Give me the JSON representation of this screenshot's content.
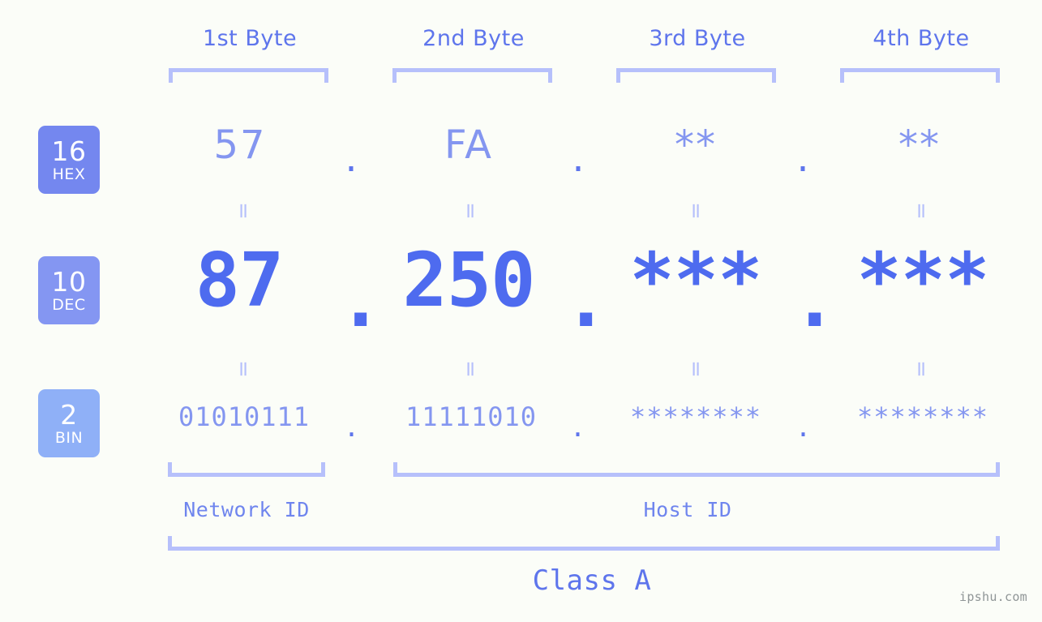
{
  "background_color": "#fbfdf8",
  "accent_color": "#4e6bef",
  "bracket_color": "#b6c0fb",
  "headers": [
    {
      "label": "1st Byte"
    },
    {
      "label": "2nd Byte"
    },
    {
      "label": "3rd Byte"
    },
    {
      "label": "4th Byte"
    }
  ],
  "bases": {
    "hex": {
      "number": "16",
      "name": "HEX",
      "color": "#7487ef"
    },
    "dec": {
      "number": "10",
      "name": "DEC",
      "color": "#8496f2"
    },
    "bin": {
      "number": "2",
      "name": "BIN",
      "color": "#8fb0f7"
    }
  },
  "rows": {
    "hex": {
      "values": [
        "57",
        "FA",
        "**",
        "**"
      ],
      "separator": "."
    },
    "dec": {
      "values": [
        "87",
        "250",
        "***",
        "***"
      ],
      "separator": "."
    },
    "bin": {
      "values": [
        "01010111",
        "11111010",
        "********",
        "********"
      ],
      "separator": "."
    }
  },
  "equality_symbol": "=",
  "sections": {
    "network_id": "Network ID",
    "host_id": "Host ID",
    "class": "Class A"
  },
  "watermark": "ipshu.com"
}
